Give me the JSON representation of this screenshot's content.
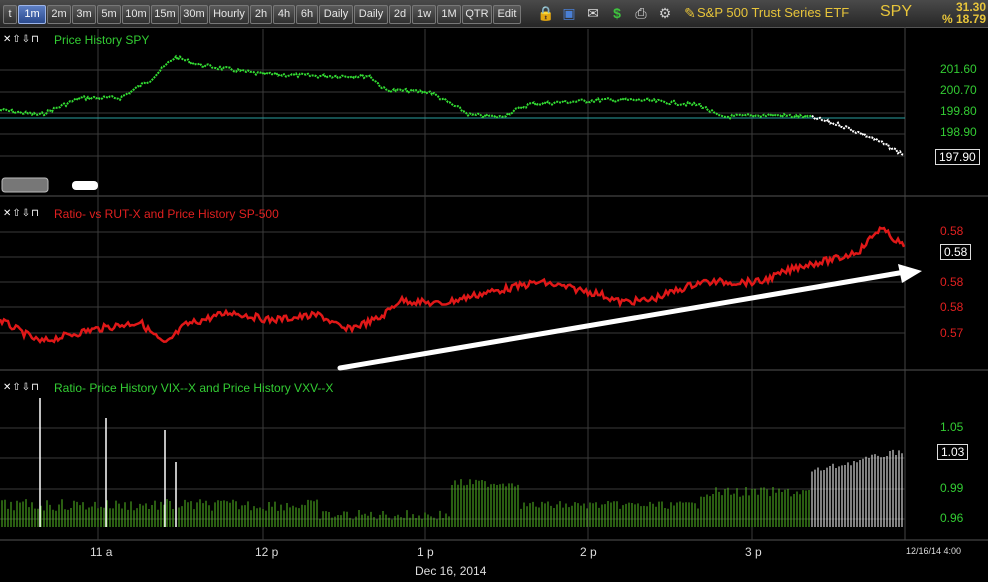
{
  "toolbar": {
    "intervals": [
      "t",
      "1m",
      "2m",
      "3m",
      "5m",
      "10m",
      "15m",
      "30m",
      "Hourly",
      "2h",
      "4h",
      "6h",
      "Daily",
      "Daily",
      "2d",
      "1w",
      "1M",
      "QTR",
      "Edit"
    ],
    "selected": "1m",
    "icons": [
      "lock-icon",
      "save-icon",
      "mail-icon",
      "dollar-icon",
      "print-icon",
      "settings-icon"
    ],
    "symbol_name": "S&P 500 Trust Series ETF",
    "ticker": "SPY",
    "stat1": "31.30",
    "stat2": "% 18.79"
  },
  "panels": {
    "spy": {
      "controls": "✕⇧⇩⊓",
      "title": "Price History SPY",
      "title_color": "#33cc33",
      "y_labels": [
        "201.60",
        "200.70",
        "199.80",
        "198.90"
      ],
      "y_label_color": "#33cc33",
      "last_value": "197.90"
    },
    "ratio_rut": {
      "controls": "✕⇧⇩⊓",
      "title": "Ratio-  vs RUT-X and  Price History SP-500",
      "title_color": "#e02020",
      "y_labels": [
        "0.58",
        "0.58",
        "0.58",
        "0.57"
      ],
      "y_label_color": "#e02020",
      "last_value": "0.58"
    },
    "ratio_vix": {
      "controls": "✕⇧⇩⊓",
      "title": "Ratio-  Price History VIX--X and  Price History VXV--X",
      "title_color": "#33cc33",
      "y_labels": [
        "1.05",
        "0.99",
        "0.96"
      ],
      "y_label_color": "#33cc33",
      "last_value": "1.03"
    }
  },
  "x_axis": {
    "labels": [
      "11 a",
      "12 p",
      "1 p",
      "2 p",
      "3 p"
    ],
    "date": "Dec 16, 2014",
    "corner_date": "12/16/14 4:00"
  },
  "colors": {
    "price_up": "#33dd33",
    "price_down_segment": "#ffffff",
    "ratio_line": "#e01818",
    "histogram": "#55bb22"
  }
}
